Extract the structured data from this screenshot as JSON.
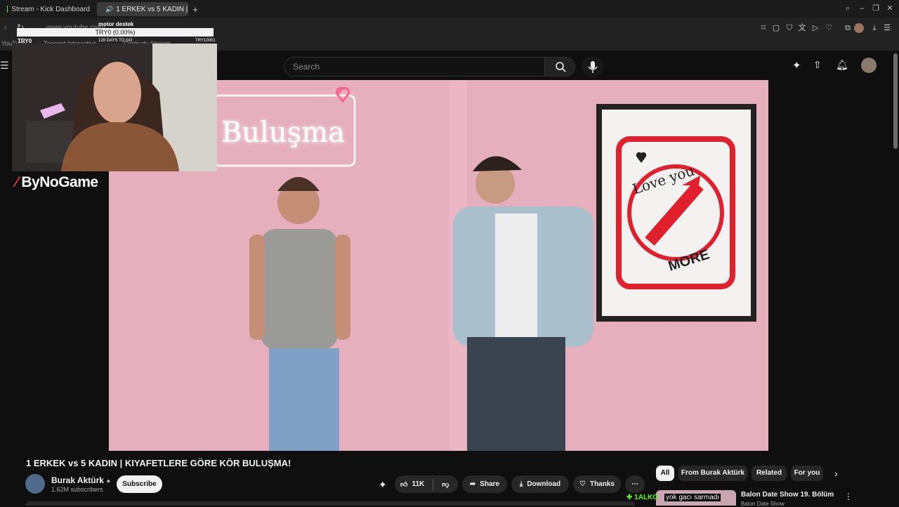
{
  "browser": {
    "tabs": [
      {
        "label": "Stream - Kick Dashboard"
      },
      {
        "label": "1 ERKEK vs 5 KADIN |"
      }
    ],
    "url": "www.youtube.com/...",
    "bookmarks": [
      "YouTube",
      "Tencent Interactive",
      "Cookudy Stream"
    ]
  },
  "overlay": {
    "goal_title": "motor destek",
    "goal_progress": "TRY0 (0.00%)",
    "goal_start": "TRY0",
    "goal_days": "128 DAYS TO GO",
    "goal_target": "TRY10001",
    "brand": "ByNoGame"
  },
  "youtube": {
    "search_placeholder": "Search",
    "video_title": "1 ERKEK vs 5 KADIN | KIYAFETLERE GÖRE KÖR BULUŞMA!",
    "channel_name": "Burak Aktürk",
    "subscribers": "1.62M subscribers",
    "subscribe_label": "Subscribe",
    "like_count": "11K",
    "share_label": "Share",
    "download_label": "Download",
    "thanks_label": "Thanks",
    "chips": [
      "All",
      "From Burak Aktürk",
      "Related",
      "For you"
    ],
    "recommended": {
      "title": "Balon Date Show 19. Bölüm",
      "channel": "Balon Date Show"
    }
  },
  "video_scene": {
    "neon_sign": "Buluşma",
    "poster_top": "Love you",
    "poster_bottom": "MORE"
  },
  "chat": {
    "user": "1ALKO",
    "message": "yok gacı sarmadı"
  },
  "colors": {
    "kick_green": "#53fc18",
    "youtube_red": "#ff0033",
    "video_pink": "#e6afbd",
    "poster_red": "#e0202c"
  }
}
